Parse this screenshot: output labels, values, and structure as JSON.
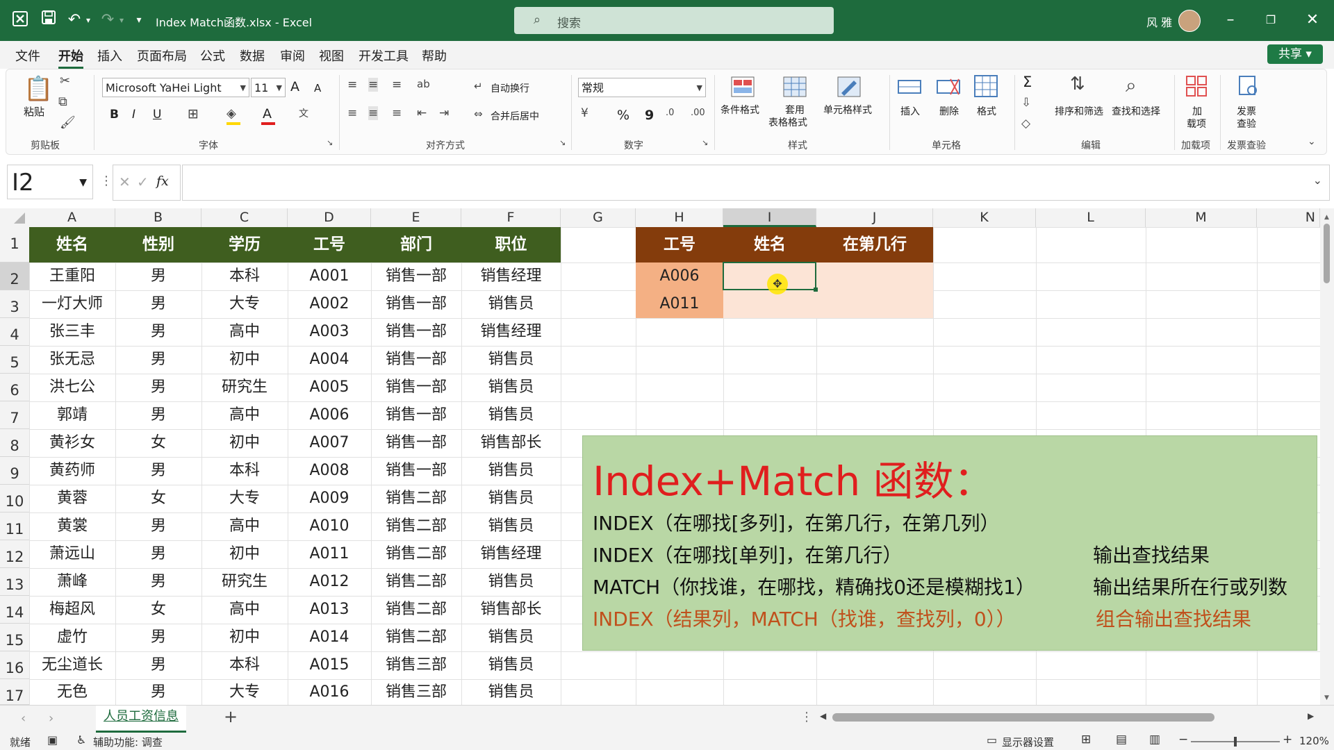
{
  "titlebar": {
    "filename": "Index Match函数.xlsx  -  Excel",
    "search_placeholder": "搜索",
    "user_name": "风 雅",
    "qat_more": "▾"
  },
  "menu": {
    "items": [
      "文件",
      "开始",
      "插入",
      "页面布局",
      "公式",
      "数据",
      "审阅",
      "视图",
      "开发工具",
      "帮助"
    ],
    "active": "开始",
    "share_label": "共享"
  },
  "ribbon": {
    "clipboard": {
      "paste": "粘贴",
      "group": "剪贴板"
    },
    "font": {
      "name": "Microsoft YaHei Light",
      "size": "11",
      "group": "字体",
      "bold": "B",
      "italic": "I",
      "underline": "U",
      "grow": "A",
      "shrink": "A"
    },
    "alignment": {
      "wrap": "自动换行",
      "merge": "合并后居中",
      "group": "对齐方式"
    },
    "number": {
      "format": "常规",
      "percent": "%",
      "comma": "9",
      "group": "数字"
    },
    "styles": {
      "conditional": "条件格式",
      "table_line1": "套用",
      "table_line2": "表格格式",
      "cell_styles": "单元格样式",
      "group": "样式"
    },
    "cells": {
      "insert": "插入",
      "delete": "删除",
      "format": "格式",
      "group": "单元格"
    },
    "editing": {
      "sum": "Σ",
      "sort": "排序和筛选",
      "find": "查找和选择",
      "group": "编辑"
    },
    "addins": {
      "label_line1": "加",
      "label_line2": "载项",
      "group": "加载项"
    },
    "invoice": {
      "label_line1": "发票",
      "label_line2": "查验",
      "group": "发票查验"
    }
  },
  "formula_bar": {
    "name_box": "I2",
    "fx": "fx",
    "formula": ""
  },
  "columns": [
    "A",
    "B",
    "C",
    "D",
    "E",
    "F",
    "G",
    "H",
    "I",
    "J",
    "K",
    "L",
    "M",
    "N"
  ],
  "selected_column": "I",
  "rows": [
    "1",
    "2",
    "3",
    "4",
    "5",
    "6",
    "7",
    "8",
    "9",
    "10",
    "11",
    "12",
    "13",
    "14",
    "15",
    "16",
    "17"
  ],
  "selected_row": "2",
  "table": {
    "headers": [
      "姓名",
      "性别",
      "学历",
      "工号",
      "部门",
      "职位"
    ],
    "header_color": "#3f5e1f",
    "rows": [
      [
        "王重阳",
        "男",
        "本科",
        "A001",
        "销售一部",
        "销售经理"
      ],
      [
        "一灯大师",
        "男",
        "大专",
        "A002",
        "销售一部",
        "销售员"
      ],
      [
        "张三丰",
        "男",
        "高中",
        "A003",
        "销售一部",
        "销售经理"
      ],
      [
        "张无忌",
        "男",
        "初中",
        "A004",
        "销售一部",
        "销售员"
      ],
      [
        "洪七公",
        "男",
        "研究生",
        "A005",
        "销售一部",
        "销售员"
      ],
      [
        "郭靖",
        "男",
        "高中",
        "A006",
        "销售一部",
        "销售员"
      ],
      [
        "黄衫女",
        "女",
        "初中",
        "A007",
        "销售一部",
        "销售部长"
      ],
      [
        "黄药师",
        "男",
        "本科",
        "A008",
        "销售一部",
        "销售员"
      ],
      [
        "黄蓉",
        "女",
        "大专",
        "A009",
        "销售二部",
        "销售员"
      ],
      [
        "黄裳",
        "男",
        "高中",
        "A010",
        "销售二部",
        "销售员"
      ],
      [
        "萧远山",
        "男",
        "初中",
        "A011",
        "销售二部",
        "销售经理"
      ],
      [
        "萧峰",
        "男",
        "研究生",
        "A012",
        "销售二部",
        "销售员"
      ],
      [
        "梅超风",
        "女",
        "高中",
        "A013",
        "销售二部",
        "销售部长"
      ],
      [
        "虚竹",
        "男",
        "初中",
        "A014",
        "销售二部",
        "销售员"
      ],
      [
        "无尘道长",
        "男",
        "本科",
        "A015",
        "销售三部",
        "销售员"
      ],
      [
        "无色",
        "男",
        "大专",
        "A016",
        "销售三部",
        "销售员"
      ]
    ]
  },
  "lookup": {
    "headers": [
      "工号",
      "姓名",
      "在第几行"
    ],
    "header_color": "#843c0c",
    "ids": [
      "A006",
      "A011"
    ],
    "id_fill": "#f4b084",
    "result_fill": "#fce4d6"
  },
  "note": {
    "title": "Index+Match 函数：",
    "lines": [
      {
        "left": "INDEX（在哪找[多列]，在第几行，在第几列）",
        "right": ""
      },
      {
        "left": "INDEX（在哪找[单列]，在第几行）",
        "right": "输出查找结果"
      },
      {
        "left": "MATCH（你找谁，在哪找，精确找0还是模糊找1）",
        "right": "输出结果所在行或列数"
      },
      {
        "left": "INDEX（结果列，MATCH（找谁，查找列，0））",
        "right": "组合输出查找结果"
      }
    ],
    "title_color": "#e01e1e",
    "highlight_color": "#c0501c"
  },
  "sheet_tabs": {
    "active": "人员工资信息",
    "add": "+"
  },
  "status": {
    "ready": "就绪",
    "accessibility": "辅助功能: 调查",
    "display_settings": "显示器设置",
    "zoom": "120%"
  }
}
